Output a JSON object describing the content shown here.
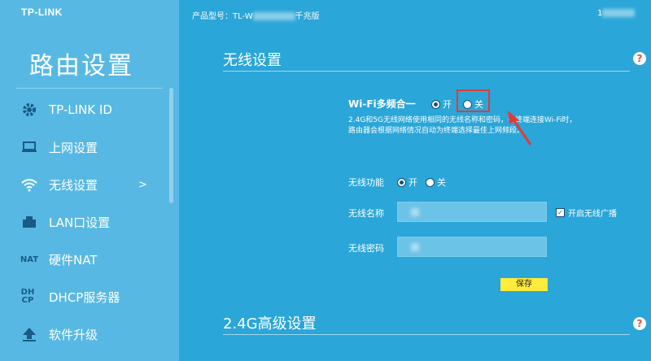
{
  "brand": {
    "logo": "TP-LINK"
  },
  "sidebar": {
    "title": "路由设置",
    "items": [
      {
        "label": "TP-LINK ID",
        "icon": "gear-icon"
      },
      {
        "label": "上网设置",
        "icon": "laptop-icon"
      },
      {
        "label": "无线设置",
        "icon": "wifi-icon",
        "active": true,
        "arrow": ">"
      },
      {
        "label": "LAN口设置",
        "icon": "ethernet-port-icon"
      },
      {
        "label": "硬件NAT",
        "icon": "nat-icon",
        "glyph": "NAT"
      },
      {
        "label": "DHCP服务器",
        "icon": "dhcp-icon",
        "glyph": "DH CP"
      },
      {
        "label": "软件升级",
        "icon": "upload-icon"
      }
    ]
  },
  "header": {
    "model_label": "产品型号：TL-W",
    "model_suffix": "千兆版",
    "right_text": "1"
  },
  "wireless": {
    "title": "无线设置",
    "help_glyph": "?",
    "multiband": {
      "label": "Wi-Fi多频合一",
      "on_label": "开",
      "off_label": "关",
      "selected": "on",
      "description_line1": "2.4G和5G无线网络使用相同的无线名称和密码，在终端连接Wi-Fi时，",
      "description_line2": "路由器会根据网络情况自动为终端选择最佳上网频段。"
    },
    "wireless_function": {
      "label": "无线功能",
      "on_label": "开",
      "off_label": "关",
      "selected": "on"
    },
    "ssid": {
      "label": "无线名称",
      "value": ""
    },
    "password": {
      "label": "无线密码",
      "value": ""
    },
    "broadcast": {
      "label": "开启无线广播",
      "checked": true,
      "check_glyph": "✓"
    },
    "save_label": "保存"
  },
  "advanced_24g": {
    "title": "2.4G高级设置",
    "help_glyph": "?"
  },
  "colors": {
    "background": "#2aa6d8",
    "sidebar": "#57b9e3",
    "annotation_red": "#e53935",
    "save_button": "#ffeb3b"
  }
}
